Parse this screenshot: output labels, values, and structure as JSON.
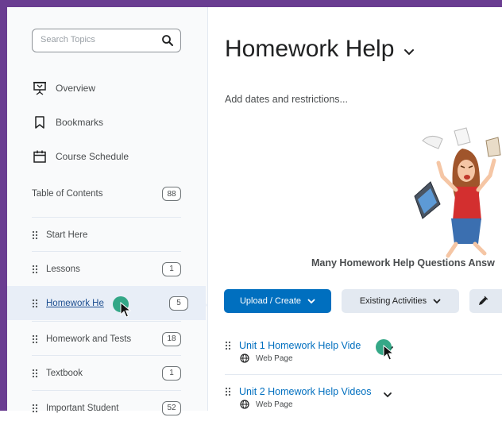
{
  "search": {
    "placeholder": "Search Topics"
  },
  "nav": [
    {
      "label": "Overview",
      "icon": "presentation-icon"
    },
    {
      "label": "Bookmarks",
      "icon": "bookmark-icon"
    },
    {
      "label": "Course Schedule",
      "icon": "calendar-icon"
    }
  ],
  "toc": {
    "label": "Table of Contents",
    "count": "88",
    "items": [
      {
        "label": "Start Here",
        "count": ""
      },
      {
        "label": "Lessons",
        "count": "1"
      },
      {
        "label": "Homework He",
        "count": "5",
        "active": true
      },
      {
        "label": "Homework and Tests",
        "count": "18"
      },
      {
        "label": "Textbook",
        "count": "1"
      },
      {
        "label": "Important Student",
        "count": "52"
      }
    ]
  },
  "main": {
    "title": "Homework Help",
    "add_dates": "Add dates and restrictions...",
    "caption": "Many Homework Help Questions Answ",
    "buttons": {
      "upload": "Upload / Create",
      "existing": "Existing Activities"
    },
    "topics": [
      {
        "title": "Unit 1 Homework Help Vide",
        "type": "Web Page"
      },
      {
        "title": "Unit 2 Homework Help Videos",
        "type": "Web Page"
      }
    ]
  },
  "colors": {
    "frame": "#6a3d91",
    "primary": "#006fbf",
    "active_bg": "#e8eef7",
    "cursor_dot": "#1f9e7a"
  }
}
